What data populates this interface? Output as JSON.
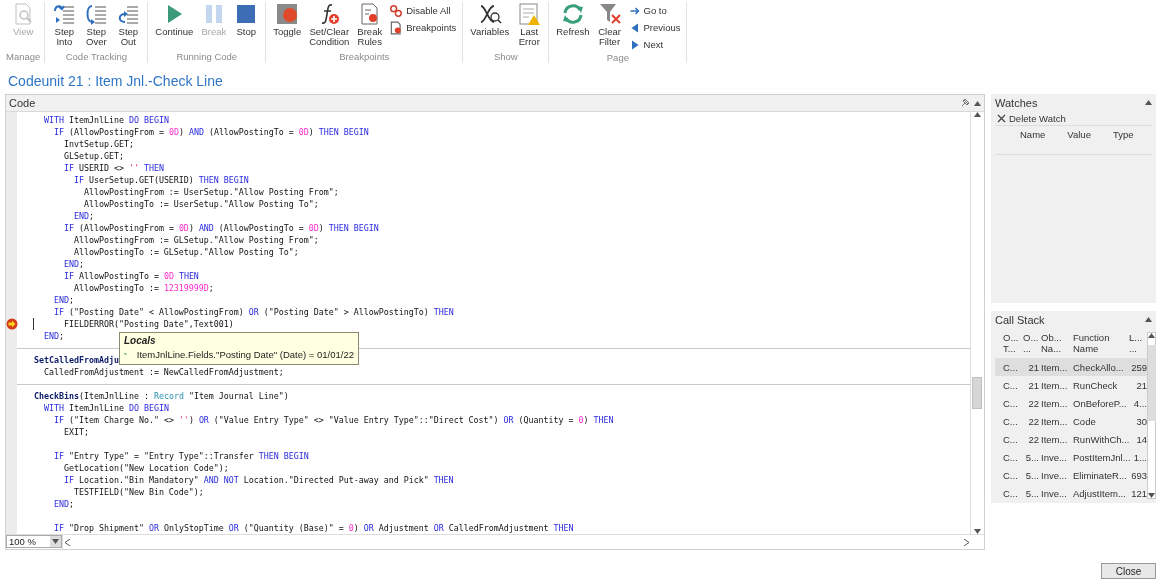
{
  "ribbon": {
    "groups": [
      {
        "label": "Manage",
        "items": [
          {
            "kind": "large",
            "label": "View",
            "disabled": true
          }
        ]
      },
      {
        "label": "Code Tracking",
        "items": [
          {
            "kind": "large",
            "label": "Step Into",
            "disabled": false
          },
          {
            "kind": "large",
            "label": "Step Over",
            "disabled": false
          },
          {
            "kind": "large",
            "label": "Step Out",
            "disabled": false
          }
        ]
      },
      {
        "label": "Running Code",
        "items": [
          {
            "kind": "large",
            "label": "Continue",
            "disabled": false
          },
          {
            "kind": "large",
            "label": "Break",
            "disabled": true
          },
          {
            "kind": "large",
            "label": "Stop",
            "disabled": false
          }
        ]
      },
      {
        "label": "Breakpoints",
        "items": [
          {
            "kind": "large",
            "label": "Toggle",
            "disabled": false
          },
          {
            "kind": "large",
            "label": "Set/Clear Condition",
            "disabled": false
          },
          {
            "kind": "large",
            "label": "Break Rules",
            "disabled": false
          },
          {
            "kind": "small",
            "label": "Disable All",
            "disabled": false
          },
          {
            "kind": "small",
            "label": "Breakpoints",
            "disabled": false
          }
        ]
      },
      {
        "label": "Show",
        "items": [
          {
            "kind": "large",
            "label": "Variables",
            "disabled": false
          },
          {
            "kind": "large",
            "label": "Last Error",
            "disabled": false
          }
        ]
      },
      {
        "label": "Page",
        "items": [
          {
            "kind": "large",
            "label": "Refresh",
            "disabled": false
          },
          {
            "kind": "large",
            "label": "Clear Filter",
            "disabled": false
          },
          {
            "kind": "small",
            "label": "Go to",
            "disabled": false
          },
          {
            "kind": "small",
            "label": "Previous",
            "disabled": false
          },
          {
            "kind": "small",
            "label": "Next",
            "disabled": false
          }
        ]
      }
    ]
  },
  "page_title": "Codeunit 21 : Item Jnl.-Check Line",
  "code": {
    "title": "Code",
    "zoom": "100 %",
    "tooltip": {
      "title": "Locals",
      "text": "ItemJnlLine.Fields.\"Posting Date\" (Date) = 01/01/22"
    },
    "lines": [
      {
        "kind": "code",
        "current": false,
        "tokens": [
          {
            "kind": "kw",
            "text": "  WITH"
          },
          {
            "kind": "plain",
            "text": " ItemJnlLine "
          },
          {
            "kind": "kw",
            "text": "DO BEGIN"
          }
        ]
      },
      {
        "kind": "code",
        "current": false,
        "tokens": [
          {
            "kind": "kw",
            "text": "    IF"
          },
          {
            "kind": "plain",
            "text": " (AllowPostingFrom = "
          },
          {
            "kind": "num",
            "text": "0D"
          },
          {
            "kind": "plain",
            "text": ") "
          },
          {
            "kind": "kw",
            "text": "AND"
          },
          {
            "kind": "plain",
            "text": " (AllowPostingTo = "
          },
          {
            "kind": "num",
            "text": "0D"
          },
          {
            "kind": "plain",
            "text": ") "
          },
          {
            "kind": "kw",
            "text": "THEN BEGIN"
          }
        ]
      },
      {
        "kind": "code",
        "current": false,
        "tokens": [
          {
            "kind": "plain",
            "text": "      InvtSetup.GET;"
          }
        ]
      },
      {
        "kind": "code",
        "current": false,
        "tokens": [
          {
            "kind": "plain",
            "text": "      GLSetup.GET;"
          }
        ]
      },
      {
        "kind": "code",
        "current": false,
        "tokens": [
          {
            "kind": "kw",
            "text": "      IF"
          },
          {
            "kind": "plain",
            "text": " USERID <> "
          },
          {
            "kind": "str",
            "text": "''"
          },
          {
            "kind": "kw",
            "text": " THEN"
          }
        ]
      },
      {
        "kind": "code",
        "current": false,
        "tokens": [
          {
            "kind": "kw",
            "text": "        IF"
          },
          {
            "kind": "plain",
            "text": " UserSetup.GET(USERID) "
          },
          {
            "kind": "kw",
            "text": "THEN BEGIN"
          }
        ]
      },
      {
        "kind": "code",
        "current": false,
        "tokens": [
          {
            "kind": "plain",
            "text": "          AllowPostingFrom := UserSetup.\"Allow Posting From\";"
          }
        ]
      },
      {
        "kind": "code",
        "current": false,
        "tokens": [
          {
            "kind": "plain",
            "text": "          AllowPostingTo := UserSetup.\"Allow Posting To\";"
          }
        ]
      },
      {
        "kind": "code",
        "current": false,
        "tokens": [
          {
            "kind": "kw",
            "text": "        END"
          },
          {
            "kind": "plain",
            "text": ";"
          }
        ]
      },
      {
        "kind": "code",
        "current": false,
        "tokens": [
          {
            "kind": "kw",
            "text": "      IF"
          },
          {
            "kind": "plain",
            "text": " (AllowPostingFrom = "
          },
          {
            "kind": "num",
            "text": "0D"
          },
          {
            "kind": "plain",
            "text": ") "
          },
          {
            "kind": "kw",
            "text": "AND"
          },
          {
            "kind": "plain",
            "text": " (AllowPostingTo = "
          },
          {
            "kind": "num",
            "text": "0D"
          },
          {
            "kind": "plain",
            "text": ") "
          },
          {
            "kind": "kw",
            "text": "THEN BEGIN"
          }
        ]
      },
      {
        "kind": "code",
        "current": false,
        "tokens": [
          {
            "kind": "plain",
            "text": "        AllowPostingFrom := GLSetup.\"Allow Posting From\";"
          }
        ]
      },
      {
        "kind": "code",
        "current": false,
        "tokens": [
          {
            "kind": "plain",
            "text": "        AllowPostingTo := GLSetup.\"Allow Posting To\";"
          }
        ]
      },
      {
        "kind": "code",
        "current": false,
        "tokens": [
          {
            "kind": "kw",
            "text": "      END"
          },
          {
            "kind": "plain",
            "text": ";"
          }
        ]
      },
      {
        "kind": "code",
        "current": false,
        "tokens": [
          {
            "kind": "kw",
            "text": "      IF"
          },
          {
            "kind": "plain",
            "text": " AllowPostingTo = "
          },
          {
            "kind": "num",
            "text": "0D"
          },
          {
            "kind": "kw",
            "text": " THEN"
          }
        ]
      },
      {
        "kind": "code",
        "current": false,
        "tokens": [
          {
            "kind": "plain",
            "text": "        AllowPostingTo := "
          },
          {
            "kind": "num",
            "text": "12319999D"
          },
          {
            "kind": "plain",
            "text": ";"
          }
        ]
      },
      {
        "kind": "code",
        "current": false,
        "tokens": [
          {
            "kind": "kw",
            "text": "    END"
          },
          {
            "kind": "plain",
            "text": ";"
          }
        ]
      },
      {
        "kind": "code",
        "current": false,
        "tokens": [
          {
            "kind": "kw",
            "text": "    IF"
          },
          {
            "kind": "plain",
            "text": " (\"Posting Date\" < AllowPostingFrom) "
          },
          {
            "kind": "kw",
            "text": "OR"
          },
          {
            "kind": "plain",
            "text": " (\"Posting Date\" > AllowPostingTo) "
          },
          {
            "kind": "kw",
            "text": "THEN"
          }
        ]
      },
      {
        "kind": "code",
        "current": true,
        "tokens": [
          {
            "kind": "plain",
            "text": "      FIELDERROR(\"Posting Date\",Text001)"
          }
        ]
      },
      {
        "kind": "code",
        "current": false,
        "tokens": [
          {
            "kind": "kw",
            "text": "  END"
          },
          {
            "kind": "plain",
            "text": ";"
          }
        ]
      },
      {
        "kind": "separator"
      },
      {
        "kind": "code",
        "current": false,
        "tokens": [
          {
            "kind": "proc",
            "text": "SetCalledFromAdju"
          }
        ]
      },
      {
        "kind": "code",
        "current": false,
        "tokens": [
          {
            "kind": "plain",
            "text": "  CalledFromAdjustment := NewCalledFromAdjustment;"
          }
        ]
      },
      {
        "kind": "separator"
      },
      {
        "kind": "code",
        "current": false,
        "tokens": [
          {
            "kind": "proc",
            "text": "CheckBins"
          },
          {
            "kind": "plain",
            "text": "(ItemJnlLine : "
          },
          {
            "kind": "type",
            "text": "Record"
          },
          {
            "kind": "plain",
            "text": " \"Item Journal Line\")"
          }
        ]
      },
      {
        "kind": "code",
        "current": false,
        "tokens": [
          {
            "kind": "kw",
            "text": "  WITH"
          },
          {
            "kind": "plain",
            "text": " ItemJnlLine "
          },
          {
            "kind": "kw",
            "text": "DO BEGIN"
          }
        ]
      },
      {
        "kind": "code",
        "current": false,
        "tokens": [
          {
            "kind": "kw",
            "text": "    IF"
          },
          {
            "kind": "plain",
            "text": " (\"Item Charge No.\" <> "
          },
          {
            "kind": "str",
            "text": "''"
          },
          {
            "kind": "plain",
            "text": ") "
          },
          {
            "kind": "kw",
            "text": "OR"
          },
          {
            "kind": "plain",
            "text": " (\"Value Entry Type\" <> \"Value Entry Type\"::\"Direct Cost\") "
          },
          {
            "kind": "kw",
            "text": "OR"
          },
          {
            "kind": "plain",
            "text": " (Quantity = "
          },
          {
            "kind": "num",
            "text": "0"
          },
          {
            "kind": "plain",
            "text": ") "
          },
          {
            "kind": "kw",
            "text": "THEN"
          }
        ]
      },
      {
        "kind": "code",
        "current": false,
        "tokens": [
          {
            "kind": "plain",
            "text": "      EXIT;"
          }
        ]
      },
      {
        "kind": "blank"
      },
      {
        "kind": "code",
        "current": false,
        "tokens": [
          {
            "kind": "kw",
            "text": "    IF"
          },
          {
            "kind": "plain",
            "text": " \"Entry Type\" = \"Entry Type\"::Transfer "
          },
          {
            "kind": "kw",
            "text": "THEN BEGIN"
          }
        ]
      },
      {
        "kind": "code",
        "current": false,
        "tokens": [
          {
            "kind": "plain",
            "text": "      GetLocation(\"New Location Code\");"
          }
        ]
      },
      {
        "kind": "code",
        "current": false,
        "tokens": [
          {
            "kind": "kw",
            "text": "      IF"
          },
          {
            "kind": "plain",
            "text": " Location.\"Bin Mandatory\" "
          },
          {
            "kind": "kw",
            "text": "AND NOT"
          },
          {
            "kind": "plain",
            "text": " Location.\"Directed Put-away and Pick\" "
          },
          {
            "kind": "kw",
            "text": "THEN"
          }
        ]
      },
      {
        "kind": "code",
        "current": false,
        "tokens": [
          {
            "kind": "plain",
            "text": "        TESTFIELD(\"New Bin Code\");"
          }
        ]
      },
      {
        "kind": "code",
        "current": false,
        "tokens": [
          {
            "kind": "kw",
            "text": "    END"
          },
          {
            "kind": "plain",
            "text": ";"
          }
        ]
      },
      {
        "kind": "blank"
      },
      {
        "kind": "code",
        "current": false,
        "tokens": [
          {
            "kind": "kw",
            "text": "    IF"
          },
          {
            "kind": "plain",
            "text": " \"Drop Shipment\" "
          },
          {
            "kind": "kw",
            "text": "OR"
          },
          {
            "kind": "plain",
            "text": " OnlyStopTime "
          },
          {
            "kind": "kw",
            "text": "OR"
          },
          {
            "kind": "plain",
            "text": " (\"Quantity (Base)\" = "
          },
          {
            "kind": "num",
            "text": "0"
          },
          {
            "kind": "plain",
            "text": ") "
          },
          {
            "kind": "kw",
            "text": "OR"
          },
          {
            "kind": "plain",
            "text": " Adjustment "
          },
          {
            "kind": "kw",
            "text": "OR"
          },
          {
            "kind": "plain",
            "text": " CalledFromAdjustment "
          },
          {
            "kind": "kw",
            "text": "THEN"
          }
        ]
      }
    ]
  },
  "watches": {
    "title": "Watches",
    "delete_label": "Delete Watch",
    "columns": [
      "Name",
      "Value",
      "Type"
    ]
  },
  "call_stack": {
    "title": "Call Stack",
    "columns": [
      "O... T...",
      "O... ...",
      "Ob... Na...",
      "Function Name",
      "L... ..."
    ],
    "rows": [
      {
        "selected": true,
        "cells": [
          "C...",
          "21",
          "Item...",
          "CheckAllo...",
          "259"
        ]
      },
      {
        "selected": false,
        "cells": [
          "C...",
          "21",
          "Item...",
          "RunCheck",
          "21"
        ]
      },
      {
        "selected": false,
        "cells": [
          "C...",
          "22",
          "Item...",
          "OnBeforeP...",
          "4..."
        ]
      },
      {
        "selected": false,
        "cells": [
          "C...",
          "22",
          "Item...",
          "Code",
          "30"
        ]
      },
      {
        "selected": false,
        "cells": [
          "C...",
          "22",
          "Item...",
          "RunWithCh...",
          "14"
        ]
      },
      {
        "selected": false,
        "cells": [
          "C...",
          "5...",
          "Inve...",
          "PostItemJnl...",
          "1..."
        ]
      },
      {
        "selected": false,
        "cells": [
          "C...",
          "5...",
          "Inve...",
          "EliminateR...",
          "693"
        ]
      },
      {
        "selected": false,
        "cells": [
          "C...",
          "5...",
          "Inve...",
          "AdjustItem...",
          "121"
        ]
      }
    ]
  },
  "close_label": "Close"
}
